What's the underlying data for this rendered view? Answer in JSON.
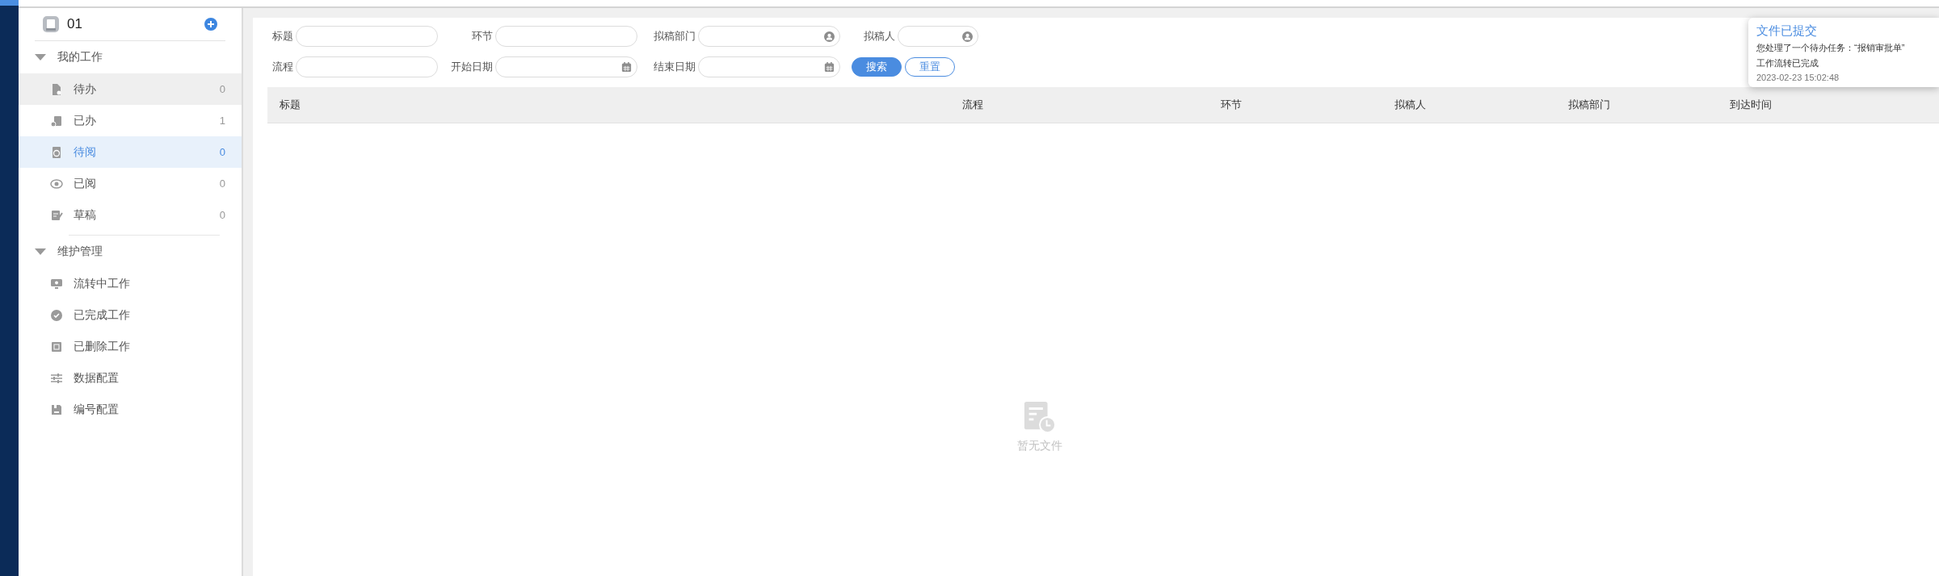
{
  "sidebar": {
    "title": "01",
    "groups": [
      {
        "label": "我的工作",
        "expanded": true,
        "items": [
          {
            "label": "待办",
            "count": "0",
            "selected": false,
            "hovered": true
          },
          {
            "label": "已办",
            "count": "1",
            "selected": false,
            "hovered": false
          },
          {
            "label": "待阅",
            "count": "0",
            "selected": true,
            "hovered": false
          },
          {
            "label": "已阅",
            "count": "0",
            "selected": false,
            "hovered": false
          },
          {
            "label": "草稿",
            "count": "0",
            "selected": false,
            "hovered": false
          }
        ]
      },
      {
        "label": "维护管理",
        "expanded": true,
        "items": [
          {
            "label": "流转中工作",
            "selected": false,
            "hovered": false
          },
          {
            "label": "已完成工作",
            "selected": false,
            "hovered": false
          },
          {
            "label": "已删除工作",
            "selected": false,
            "hovered": false
          },
          {
            "label": "数据配置",
            "selected": false,
            "hovered": false
          },
          {
            "label": "编号配置",
            "selected": false,
            "hovered": false
          }
        ]
      }
    ]
  },
  "filters": [
    [
      {
        "label": "标题",
        "kind": "text"
      },
      {
        "label": "环节",
        "kind": "text"
      },
      {
        "label": "拟稿部门",
        "kind": "person"
      },
      {
        "label": "拟稿人",
        "kind": "person"
      }
    ],
    [
      {
        "label": "流程",
        "kind": "text"
      },
      {
        "label": "开始日期",
        "kind": "date"
      },
      {
        "label": "结束日期",
        "kind": "date"
      }
    ]
  ],
  "buttons": [
    {
      "label": "搜索",
      "kind": "primary"
    },
    {
      "label": "重置",
      "kind": "outline"
    }
  ],
  "table": {
    "columns": [
      "标题",
      "流程",
      "环节",
      "拟稿人",
      "拟稿部门",
      "到达时间"
    ],
    "empty_text": "暂无文件"
  },
  "notification": {
    "title": "文件已提交",
    "lines": [
      "您处理了一个待办任务：“报销审批单”",
      "工作流转已完成"
    ],
    "time": "2023-02-23 15:02:48"
  }
}
